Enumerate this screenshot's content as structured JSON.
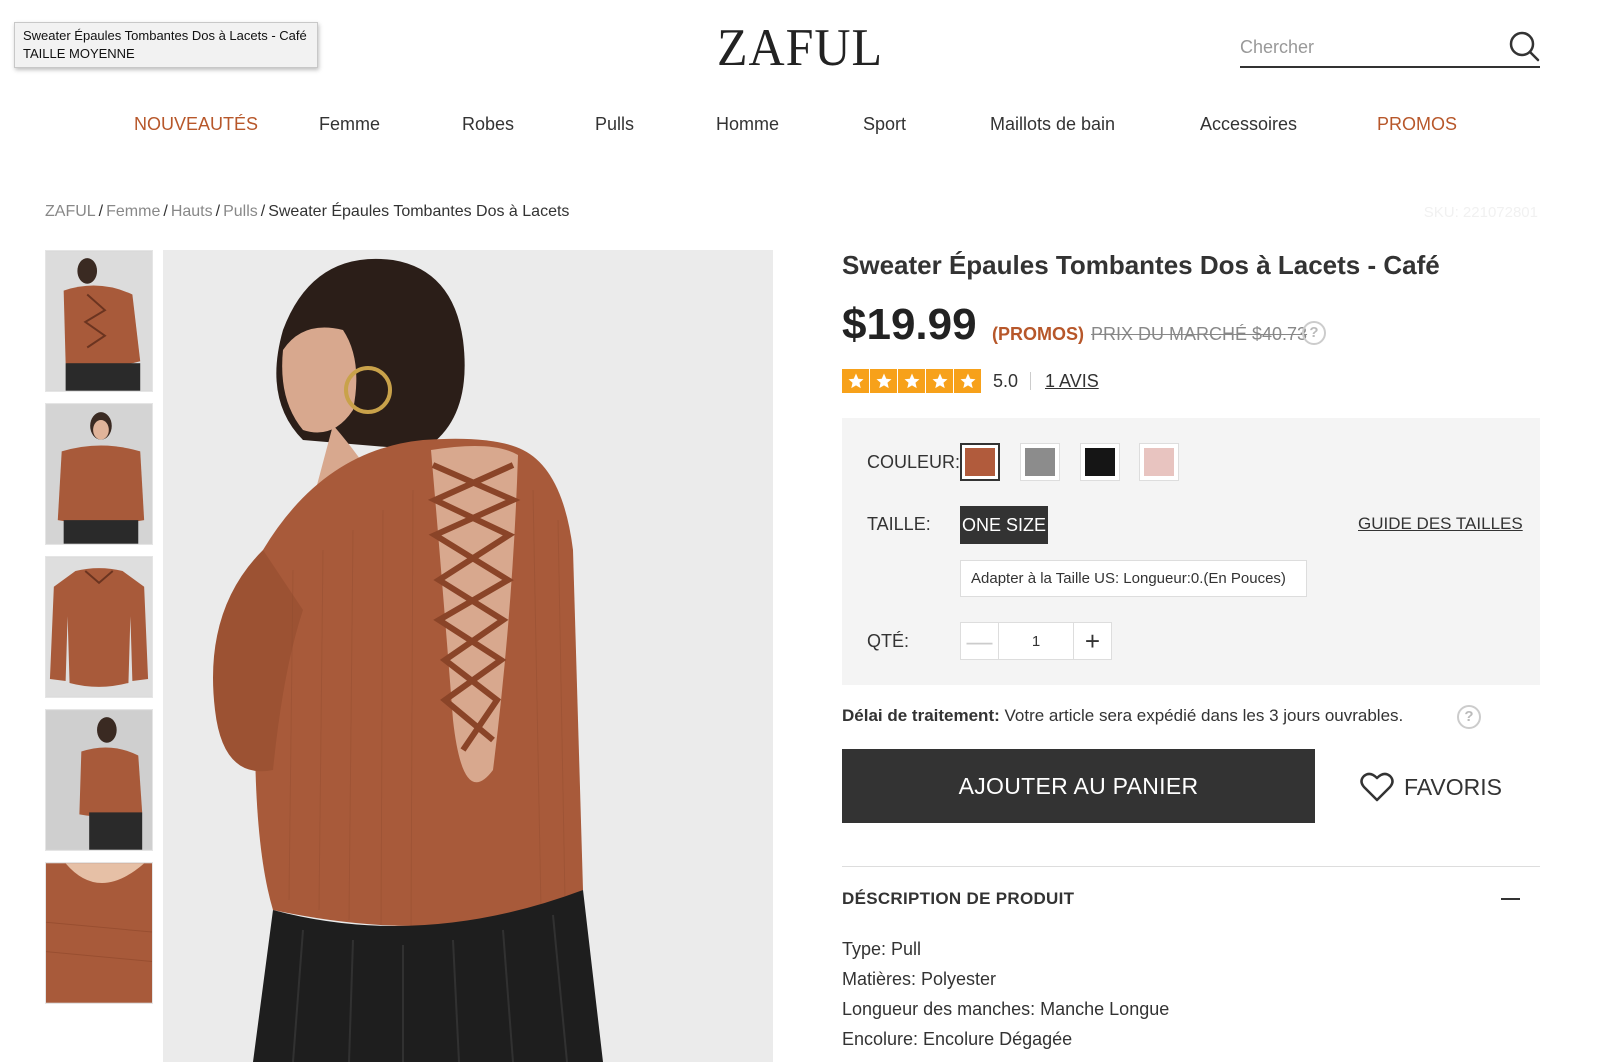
{
  "tooltip": {
    "text": "Sweater Épaules Tombantes Dos à Lacets - Café TAILLE MOYENNE"
  },
  "header": {
    "logo": "ZAFUL",
    "search_placeholder": "Chercher"
  },
  "nav": {
    "items": [
      {
        "label": "NOUVEAUTÉS"
      },
      {
        "label": "Femme"
      },
      {
        "label": "Robes"
      },
      {
        "label": "Pulls"
      },
      {
        "label": "Homme"
      },
      {
        "label": "Sport"
      },
      {
        "label": "Maillots de bain"
      },
      {
        "label": "Accessoires"
      },
      {
        "label": "PROMOS"
      }
    ]
  },
  "breadcrumb": {
    "items": [
      "ZAFUL",
      "Femme",
      "Hauts",
      "Pulls"
    ],
    "current": "Sweater Épaules Tombantes Dos à Lacets",
    "sep": "/"
  },
  "sku": "SKU: 221072801",
  "product": {
    "title": "Sweater Épaules Tombantes Dos à Lacets - Café",
    "price": "$19.99",
    "promo_label": "(PROMOS)",
    "market_price": "PRIX DU MARCHÉ $40.73",
    "help": "?",
    "rating": 5,
    "rating_text": "5.0",
    "reviews_link": "1 AVIS"
  },
  "options": {
    "color_label": "COULEUR:",
    "colors": [
      {
        "name": "Café",
        "hex": "#b15b3c",
        "selected": true
      },
      {
        "name": "Gris",
        "hex": "#8c8c8c",
        "selected": false
      },
      {
        "name": "Noir",
        "hex": "#151515",
        "selected": false
      },
      {
        "name": "Rose",
        "hex": "#e8c4c0",
        "selected": false
      }
    ],
    "size_label": "TAILLE:",
    "size_value": "ONE SIZE",
    "size_guide": "GUIDE DES TAILLES",
    "fit_text": "Adapter à la Taille US:   Longueur:0.(En Pouces)",
    "qty_label": "QTÉ:",
    "qty_minus": "—",
    "qty_value": "1",
    "qty_plus": "+"
  },
  "shipping": {
    "label": "Délai de traitement:",
    "text": " Votre article sera expédié dans les 3 jours ouvrables."
  },
  "actions": {
    "add_to_cart": "AJOUTER AU PANIER",
    "favorites": "FAVORIS"
  },
  "description": {
    "heading": "DÉSCRIPTION DE PRODUIT",
    "items": [
      "Type: Pull",
      "Matières: Polyester",
      "Longueur des manches: Manche Longue",
      "Encolure: Encolure Dégagée"
    ]
  },
  "colors": {
    "accent": "#b7572a",
    "star": "#f7a11a",
    "dark": "#333333",
    "sweater": "#a85a3a"
  }
}
